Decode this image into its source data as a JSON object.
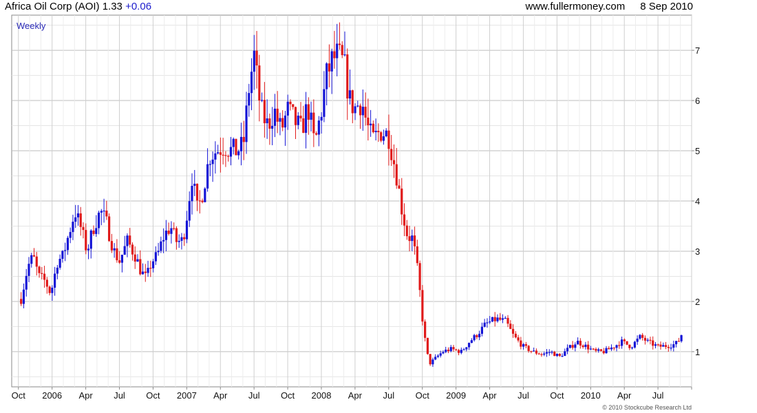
{
  "header": {
    "name": "Africa Oil Corp (AOI)",
    "price": "1.33",
    "change": "+0.06",
    "site": "www.fullermoney.com",
    "date": "8 Sep 2010"
  },
  "colors": {
    "up": "#1414d6",
    "down": "#e01a1a",
    "grid": "#d6d6d6",
    "frame": "#8a8a8a"
  },
  "chart_data": {
    "type": "candlestick",
    "period": "Weekly",
    "x_tick_labels": [
      "Oct",
      "2006",
      "Apr",
      "Jul",
      "Oct",
      "2007",
      "Apr",
      "Jul",
      "Oct",
      "2008",
      "Apr",
      "Jul",
      "Oct",
      "2009",
      "Apr",
      "Jul",
      "Oct",
      "2010",
      "Apr",
      "Jul"
    ],
    "y_ticks": [
      1,
      2,
      3,
      4,
      5,
      6,
      7
    ],
    "ylim": [
      0.3,
      7.7
    ],
    "y_axis_side": "right",
    "grid": true,
    "copyright": "© 2010 Stockcube Research Ltd",
    "anchors": [
      [
        2005.77,
        2.05
      ],
      [
        2005.82,
        2.7
      ],
      [
        2005.86,
        2.9
      ],
      [
        2005.9,
        2.5
      ],
      [
        2005.95,
        2.4
      ],
      [
        2005.99,
        2.15
      ],
      [
        2006.04,
        2.8
      ],
      [
        2006.08,
        2.9
      ],
      [
        2006.12,
        3.3
      ],
      [
        2006.17,
        3.8
      ],
      [
        2006.21,
        3.5
      ],
      [
        2006.26,
        3.0
      ],
      [
        2006.31,
        3.5
      ],
      [
        2006.36,
        3.8
      ],
      [
        2006.4,
        3.6
      ],
      [
        2006.46,
        3.0
      ],
      [
        2006.5,
        2.8
      ],
      [
        2006.56,
        3.2
      ],
      [
        2006.62,
        2.9
      ],
      [
        2006.66,
        2.6
      ],
      [
        2006.7,
        2.45
      ],
      [
        2006.74,
        2.8
      ],
      [
        2006.78,
        2.9
      ],
      [
        2006.83,
        3.3
      ],
      [
        2006.88,
        3.5
      ],
      [
        2006.92,
        3.2
      ],
      [
        2006.97,
        3.2
      ],
      [
        2007.0,
        3.7
      ],
      [
        2007.04,
        4.5
      ],
      [
        2007.08,
        3.8
      ],
      [
        2007.12,
        4.2
      ],
      [
        2007.17,
        4.9
      ],
      [
        2007.22,
        5.0
      ],
      [
        2007.28,
        5.1
      ],
      [
        2007.33,
        5.0
      ],
      [
        2007.37,
        5.0
      ],
      [
        2007.42,
        5.1
      ],
      [
        2007.46,
        6.2
      ],
      [
        2007.5,
        6.9
      ],
      [
        2007.55,
        5.8
      ],
      [
        2007.6,
        5.5
      ],
      [
        2007.65,
        5.8
      ],
      [
        2007.7,
        5.4
      ],
      [
        2007.75,
        5.8
      ],
      [
        2007.8,
        5.6
      ],
      [
        2007.85,
        5.4
      ],
      [
        2007.9,
        5.9
      ],
      [
        2007.95,
        5.1
      ],
      [
        2008.0,
        5.8
      ],
      [
        2008.04,
        6.5
      ],
      [
        2008.08,
        6.8
      ],
      [
        2008.12,
        6.9
      ],
      [
        2008.17,
        6.7
      ],
      [
        2008.21,
        6.0
      ],
      [
        2008.25,
        5.85
      ],
      [
        2008.3,
        6.0
      ],
      [
        2008.34,
        5.5
      ],
      [
        2008.38,
        5.2
      ],
      [
        2008.44,
        5.4
      ],
      [
        2008.5,
        5.3
      ],
      [
        2008.56,
        4.5
      ],
      [
        2008.6,
        3.8
      ],
      [
        2008.64,
        3.3
      ],
      [
        2008.68,
        3.25
      ],
      [
        2008.72,
        2.5
      ],
      [
        2008.76,
        1.4
      ],
      [
        2008.8,
        0.75
      ],
      [
        2008.84,
        0.85
      ],
      [
        2008.9,
        1.0
      ],
      [
        2008.96,
        1.05
      ],
      [
        2009.04,
        1.0
      ],
      [
        2009.1,
        1.2
      ],
      [
        2009.16,
        1.35
      ],
      [
        2009.22,
        1.55
      ],
      [
        2009.3,
        1.65
      ],
      [
        2009.37,
        1.6
      ],
      [
        2009.43,
        1.3
      ],
      [
        2009.5,
        1.1
      ],
      [
        2009.57,
        1.0
      ],
      [
        2009.64,
        0.95
      ],
      [
        2009.7,
        1.0
      ],
      [
        2009.77,
        0.9
      ],
      [
        2009.83,
        1.05
      ],
      [
        2009.9,
        1.2
      ],
      [
        2009.97,
        1.1
      ],
      [
        2010.03,
        1.0
      ],
      [
        2010.1,
        1.0
      ],
      [
        2010.17,
        1.1
      ],
      [
        2010.23,
        1.2
      ],
      [
        2010.3,
        1.1
      ],
      [
        2010.37,
        1.3
      ],
      [
        2010.42,
        1.2
      ],
      [
        2010.5,
        1.1
      ],
      [
        2010.57,
        1.12
      ],
      [
        2010.63,
        1.15
      ],
      [
        2010.69,
        1.33
      ]
    ]
  }
}
